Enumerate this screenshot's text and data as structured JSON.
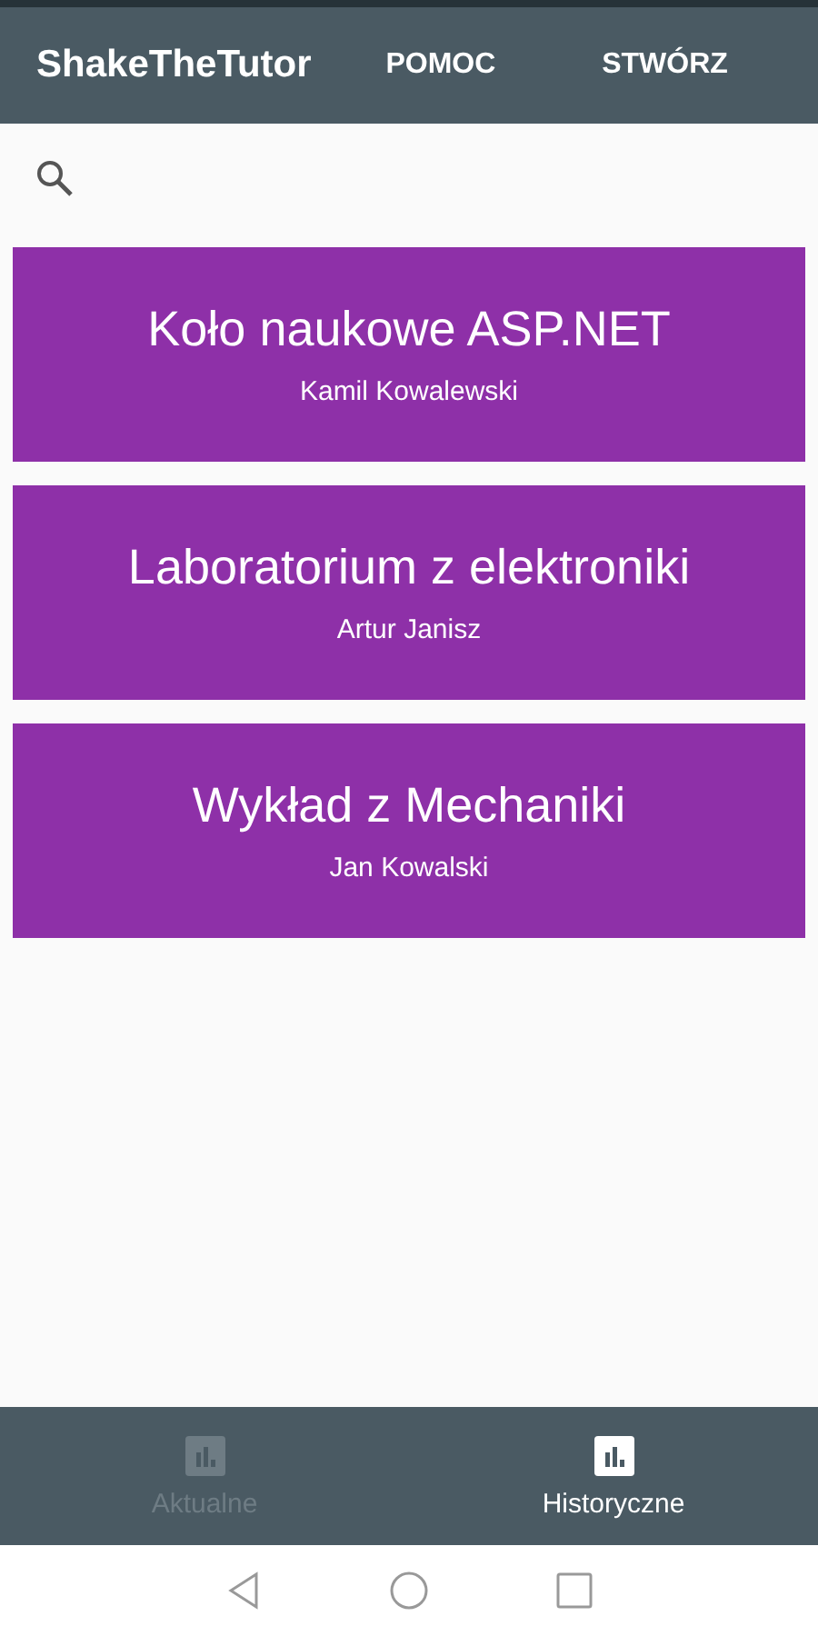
{
  "app_bar": {
    "title": "ShakeTheTutor",
    "actions": [
      "POMOC",
      "STWÓRZ"
    ]
  },
  "courses": [
    {
      "title": "Koło naukowe ASP.NET",
      "tutor": "Kamil Kowalewski"
    },
    {
      "title": "Laboratorium z elektroniki",
      "tutor": "Artur Janisz"
    },
    {
      "title": "Wykład z Mechaniki",
      "tutor": "Jan Kowalski"
    }
  ],
  "bottom_nav": [
    {
      "label": "Aktualne",
      "selected": false
    },
    {
      "label": "Historyczne",
      "selected": true
    }
  ]
}
